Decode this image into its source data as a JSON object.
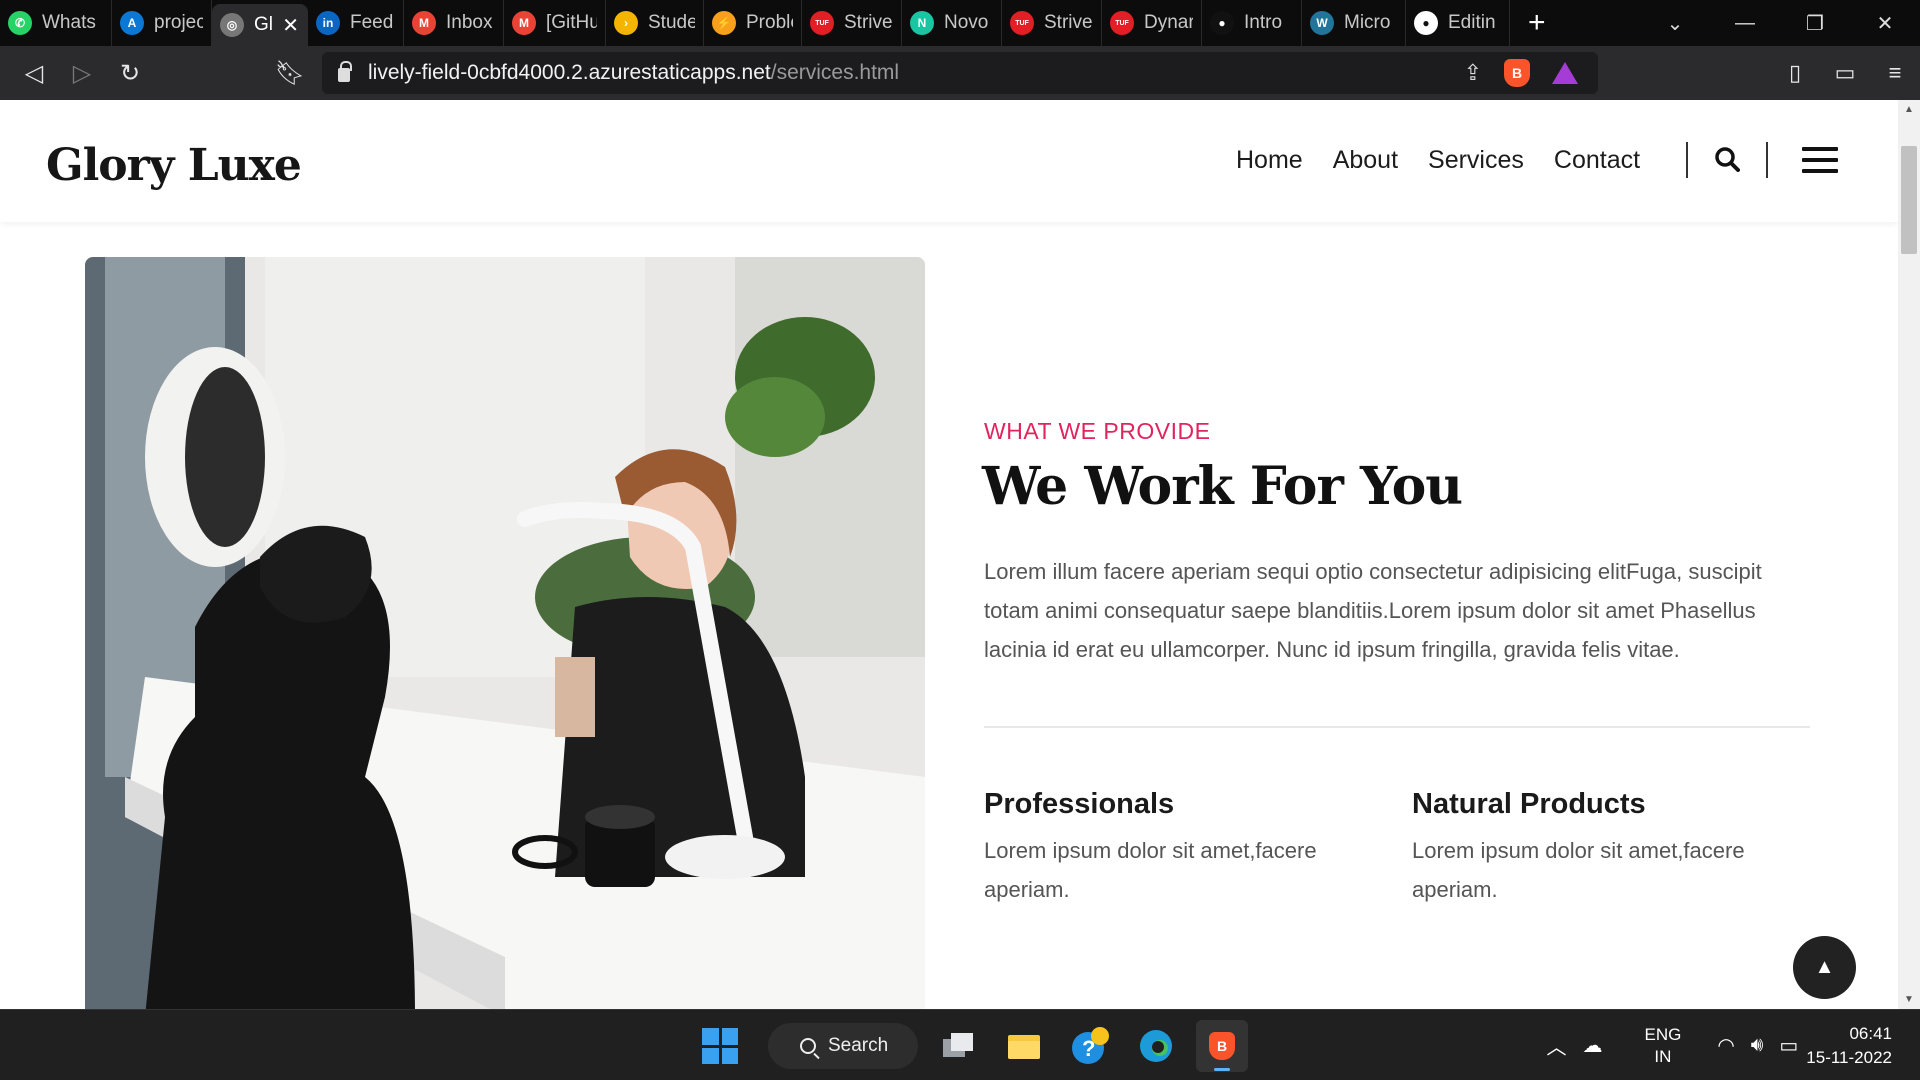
{
  "browser": {
    "tabs": [
      {
        "label": "Whats",
        "icon": "whatsapp-icon",
        "color": "#25D366",
        "glyph": "✆",
        "width": 112
      },
      {
        "label": "projec",
        "icon": "azure-icon",
        "color": "#0a78d4",
        "glyph": "A",
        "width": 100
      },
      {
        "label": "Gl",
        "icon": "globe-icon",
        "color": "#777777",
        "glyph": "◎",
        "width": 96,
        "active": true
      },
      {
        "label": "Feed",
        "icon": "linkedin-icon",
        "color": "#0a66c2",
        "glyph": "in",
        "width": 96
      },
      {
        "label": "Inbox",
        "icon": "gmail-icon",
        "color": "#ea4335",
        "glyph": "M",
        "width": 100
      },
      {
        "label": "[GitHu",
        "icon": "gmail-icon",
        "color": "#ea4335",
        "glyph": "M",
        "width": 102
      },
      {
        "label": "Stude",
        "icon": "google-classroom-icon",
        "color": "#f4b400",
        "glyph": "›",
        "width": 98
      },
      {
        "label": "Proble",
        "icon": "leetcode-icon",
        "color": "#f89f1b",
        "glyph": "⚡",
        "width": 98
      },
      {
        "label": "Strive",
        "icon": "tuf-icon",
        "color": "#e31e24",
        "glyph": "TUF",
        "width": 100
      },
      {
        "label": "Novo",
        "icon": "novo-icon",
        "color": "#1ac5a1",
        "glyph": "N",
        "width": 100
      },
      {
        "label": "Strive",
        "icon": "tuf-icon",
        "color": "#e31e24",
        "glyph": "TUF",
        "width": 100
      },
      {
        "label": "Dynar",
        "icon": "tuf-icon",
        "color": "#e31e24",
        "glyph": "TUF",
        "width": 100
      },
      {
        "label": "Intro",
        "icon": "github-icon",
        "color": "#111111",
        "glyph": "●",
        "width": 100
      },
      {
        "label": "Micro",
        "icon": "wordpress-icon",
        "color": "#21759b",
        "glyph": "W",
        "width": 104
      },
      {
        "label": "Editin",
        "icon": "github-icon",
        "color": "#ffffff",
        "glyph": "●",
        "width": 104
      }
    ],
    "url_host": "lively-field-0cbfd4000.2.azurestaticapps.net",
    "url_path": "/services.html"
  },
  "site": {
    "logo": "Glory Luxe",
    "nav": [
      "Home",
      "About",
      "Services",
      "Contact"
    ],
    "accent_color": "#e0245e",
    "eyebrow": "WHAT WE PROVIDE",
    "headline": "We Work For You",
    "intro": "Lorem illum facere aperiam sequi optio consectetur adipisicing elitFuga, suscipit totam animi consequatur saepe blanditiis.Lorem ipsum dolor sit amet Phasellus lacinia id erat eu ullamcorper. Nunc id ipsum fringilla, gravida felis vitae.",
    "features": [
      {
        "title": "Professionals",
        "text": "Lorem ipsum dolor sit amet,facere aperiam."
      },
      {
        "title": "Natural Products",
        "text": "Lorem ipsum dolor sit amet,facere aperiam."
      }
    ]
  },
  "taskbar": {
    "search_label": "Search",
    "lang_line1": "ENG",
    "lang_line2": "IN",
    "time": "06:41",
    "date": "15-11-2022"
  }
}
